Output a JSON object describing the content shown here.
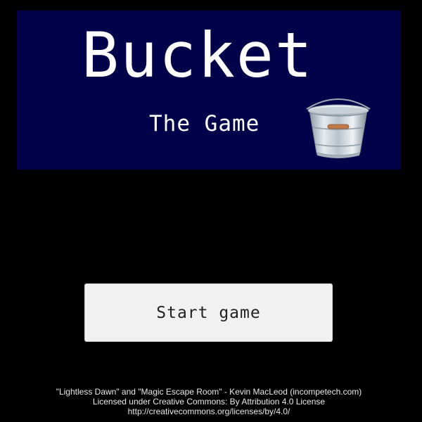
{
  "title": {
    "main": "Bucket",
    "subtitle": "The Game",
    "panel_color": "#02024a",
    "bucket_icon": "metal-bucket-icon"
  },
  "menu": {
    "start_label": "Start game"
  },
  "credits": {
    "line1": "\"Lightless Dawn\" and  \"Magic Escape Room\" - Kevin MacLeod (incompetech.com)",
    "line2": "Licensed under Creative Commons: By Attribution 4.0 License",
    "line3": "http://creativecommons.org/licenses/by/4.0/"
  }
}
